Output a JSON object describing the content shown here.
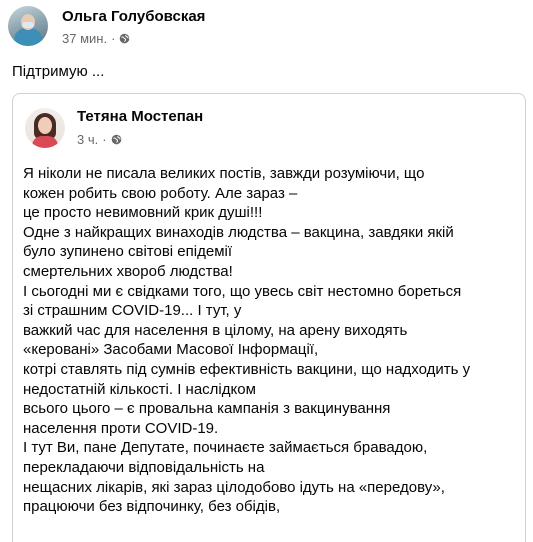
{
  "post": {
    "author": "Ольга Голубовская",
    "time": "37 мин.",
    "visibility_icon": "globe-icon",
    "caption": "Підтримую ..."
  },
  "shared_post": {
    "author": "Тетяна Мостепан",
    "time": "3 ч.",
    "visibility_icon": "globe-icon",
    "lines": [
      "Я ніколи не писала великих постів, завжди розуміючи, що",
      "кожен робить свою роботу. Але зараз –",
      "це просто невимовний крик душі!!!",
      "Одне з найкращих винаходів людства – вакцина, завдяки якій",
      "було зупинено світові епідемії",
      "смертельних хвороб людства!",
      "І сьогодні ми є свідками того, що увесь світ нестомно бореться",
      "зі страшним COVID-19... І тут, у",
      "важкий час для населення в цілому, на арену виходять",
      "«керовані» Засобами Масової Інформації,",
      "котрі ставлять під сумнів ефективність вакцини, що надходить у",
      "недостатній кількості. І наслідком",
      "всього цього – є провальна кампанія з вакцинування",
      "населення проти COVID-19.",
      "І тут Ви, пане Депутате, починаєте займається бравадою,",
      "перекладаючи відповідальність на",
      "нещасних лікарів, які зараз цілодобово ідуть на «передову»,",
      "працюючи без відпочинку, без обідів,"
    ]
  }
}
